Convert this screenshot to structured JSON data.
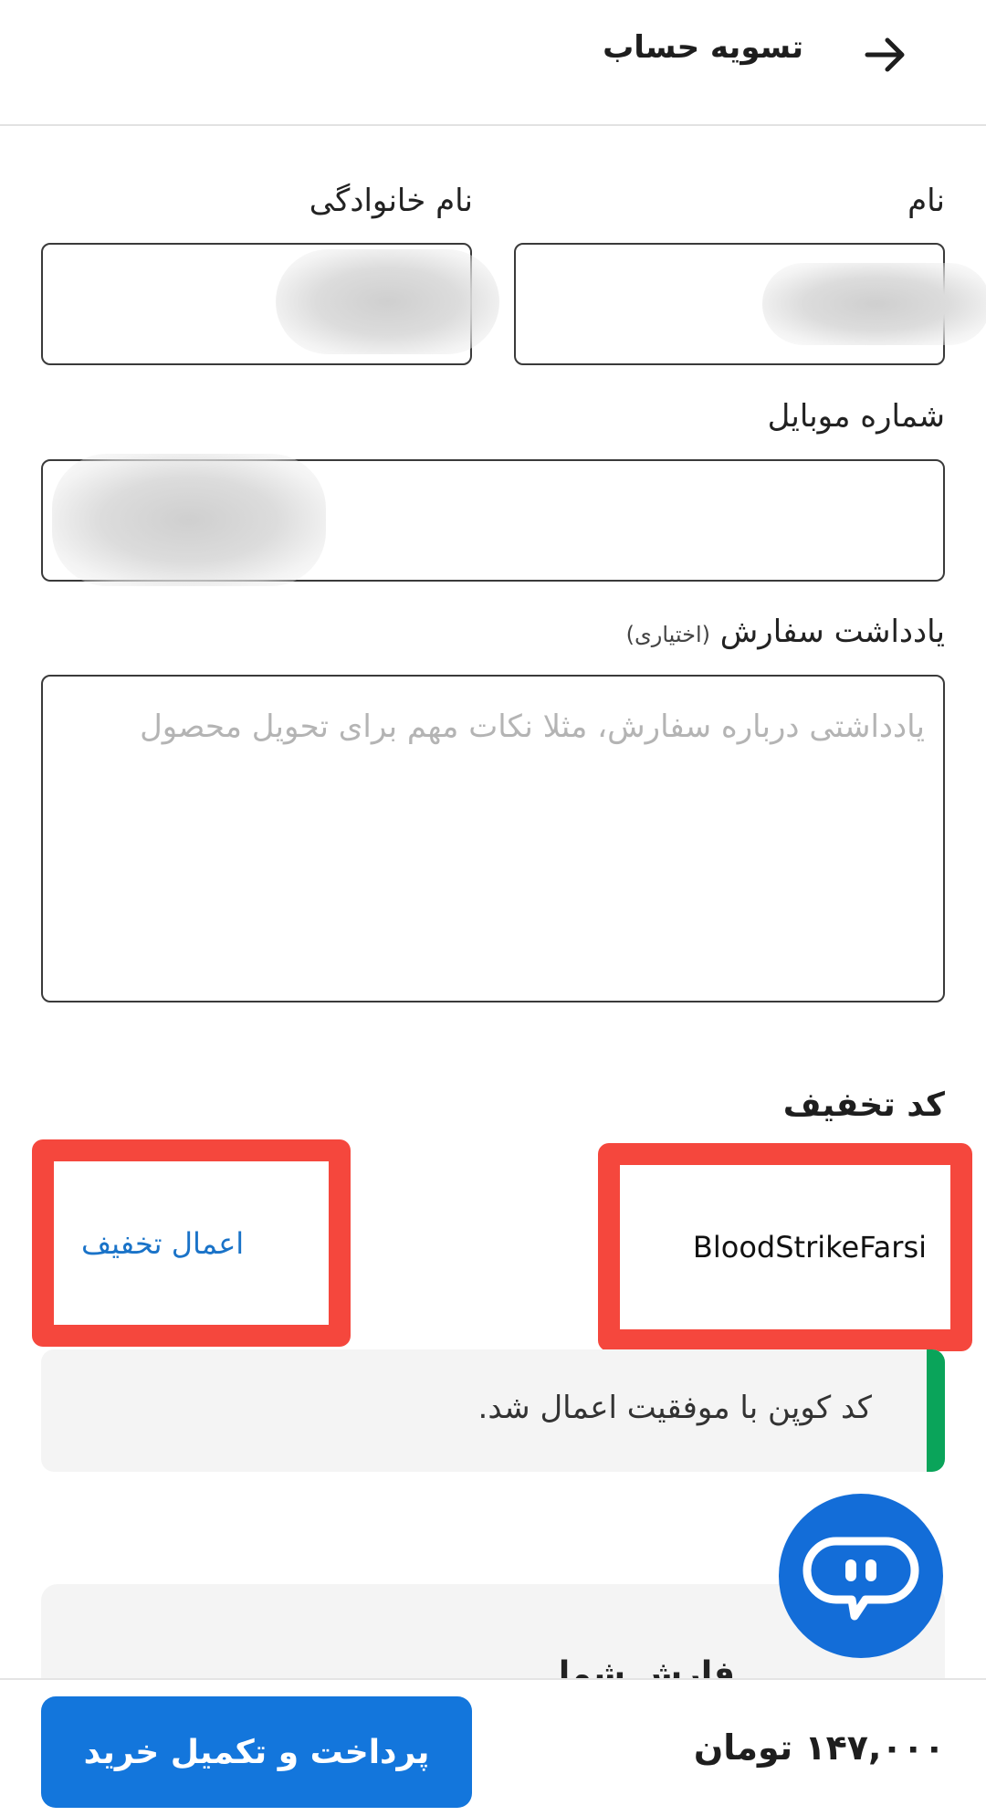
{
  "header": {
    "title": "تسویه حساب",
    "back_icon": "arrow-right-icon"
  },
  "form": {
    "first_name_label": "نام",
    "last_name_label": "نام خانوادگی",
    "mobile_label": "شماره موبایل",
    "note_label": "یادداشت سفارش",
    "note_optional": "(اختیاری)",
    "note_placeholder": "یادداشتی درباره سفارش، مثلا نکات مهم برای تحویل محصول"
  },
  "coupon": {
    "title": "کد تخفیف",
    "code_value": "BloodStrikeFarsi",
    "apply_label": "اعمال تخفیف",
    "success_message": "کد کوپن با موفقیت اعمال شد."
  },
  "summary": {
    "title_partial": "فارش شما"
  },
  "chat": {
    "icon": "chat-bot-icon"
  },
  "footer": {
    "total": "۱۴۷,۰۰۰ تومان",
    "pay_label": "پرداخت و تکمیل خرید"
  },
  "colors": {
    "accent": "#1376dc",
    "highlight": "#f5473d",
    "success": "#0aa45a",
    "link": "#1a73c8"
  }
}
